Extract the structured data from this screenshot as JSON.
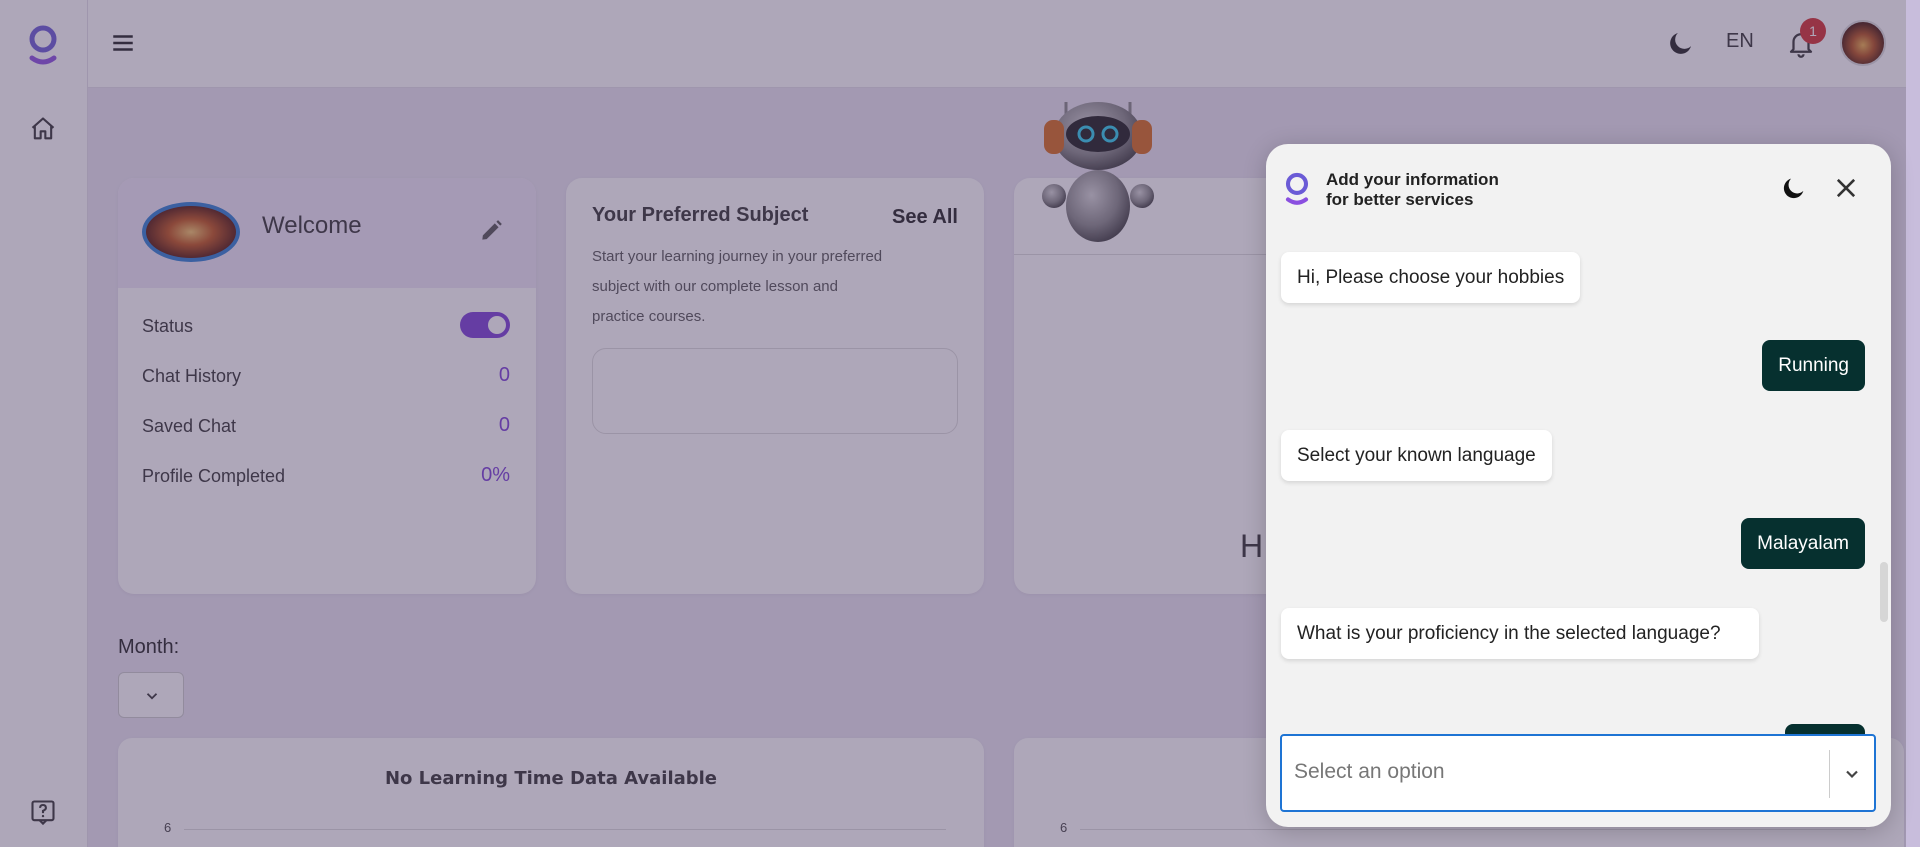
{
  "header": {
    "language": "EN",
    "notification_count": "1"
  },
  "welcome": {
    "title": "Welcome",
    "stats": [
      {
        "label": "Status"
      },
      {
        "label": "Chat History",
        "value": "0"
      },
      {
        "label": "Saved Chat",
        "value": "0"
      },
      {
        "label": "Profile Completed",
        "value": "0%"
      }
    ]
  },
  "subject": {
    "title": "Your Preferred Subject",
    "see_all": "See All",
    "description": "Start your learning journey in your preferred subject with our complete lesson and practice courses."
  },
  "third_card": {
    "partial_text": "H"
  },
  "month": {
    "label": "Month:"
  },
  "charts": [
    {
      "title": "No Learning Time Data Available",
      "ytick": "6"
    },
    {
      "title": "",
      "ytick": "6"
    }
  ],
  "chat": {
    "title_line1": "Add your information",
    "title_line2": "for better services",
    "messages": [
      {
        "from": "bot",
        "text": "Hi, Please choose your hobbies"
      },
      {
        "from": "user",
        "text": "Running"
      },
      {
        "from": "bot",
        "text": "Select your known language"
      },
      {
        "from": "user",
        "text": "Malayalam"
      },
      {
        "from": "bot",
        "text": "What is your proficiency in the selected language?"
      }
    ],
    "select_placeholder": "Select an option"
  },
  "colors": {
    "accent": "#7b3fd8",
    "user_bubble": "#06302f",
    "badge": "#d32f2f",
    "focus_border": "#1e74d4"
  }
}
